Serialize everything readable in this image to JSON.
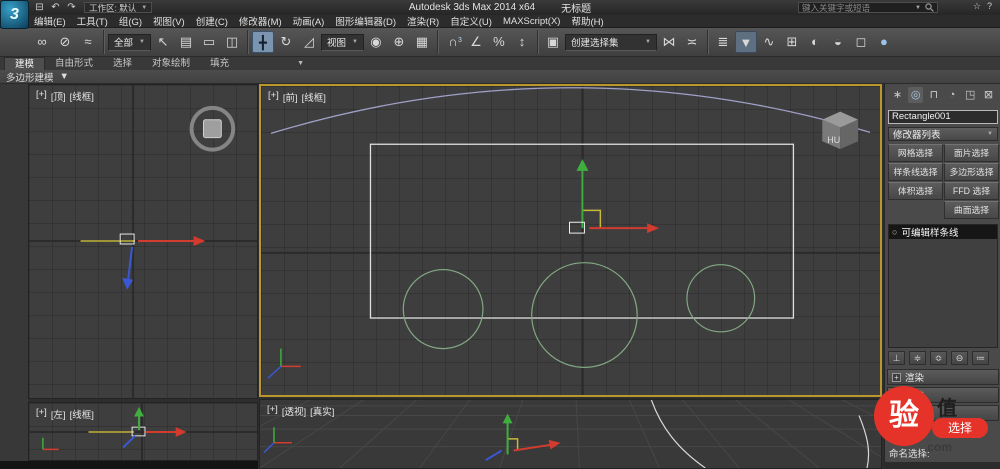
{
  "titlebar": {
    "workspace": "工作区: 默认",
    "product": "Autodesk 3ds Max  2014 x64",
    "document": "无标题",
    "search_placeholder": "键入关键字或短语"
  },
  "menubar": {
    "items": [
      "编辑(E)",
      "工具(T)",
      "组(G)",
      "视图(V)",
      "创建(C)",
      "修改器(M)",
      "动画(A)",
      "图形编辑器(D)",
      "渲染(R)",
      "自定义(U)",
      "MAXScript(X)",
      "帮助(H)"
    ]
  },
  "toolbar": {
    "filter_value": "全部",
    "coord_value": "视图",
    "selection_set_placeholder": "创建选择集",
    "snap_level": "3"
  },
  "ribbon": {
    "tabs": [
      "建模",
      "自由形式",
      "选择",
      "对象绘制",
      "填充"
    ],
    "panel_label": "多边形建模"
  },
  "viewports": {
    "top": {
      "plus": "[+]",
      "name": "[顶]",
      "shading": "[线框]"
    },
    "front": {
      "plus": "[+]",
      "name": "[前]",
      "shading": "[线框]"
    },
    "left": {
      "plus": "[+]",
      "name": "[左]",
      "shading": "[线框]"
    },
    "perspective": {
      "plus": "[+]",
      "name": "[透视]",
      "shading": "[真实]"
    },
    "viewcube_label": "HU"
  },
  "command_panel": {
    "object_name": "Rectangle001",
    "modifier_list": "修改器列表",
    "selection_buttons": [
      "网格选择",
      "面片选择",
      "样条线选择",
      "多边形选择",
      "体积选择",
      "FFD 选择",
      "",
      "曲面选择"
    ],
    "stack_items": [
      "可编辑样条线"
    ],
    "rollouts": [
      "渲染",
      "插值",
      "选择"
    ],
    "named_selection_label": "命名选择:"
  },
  "watermark": {
    "badge": "验",
    "char": "值",
    "pill": "选择",
    "suffix": ".com"
  },
  "icons": {
    "save": "⊟",
    "undo": "↶",
    "redo": "↷",
    "star": "☆",
    "help": "?",
    "dropdown_arrow": "▼",
    "expand": "+",
    "link": "∞",
    "unlink": "⊘",
    "bind": "≈",
    "select": "↖",
    "select_by_name": "▤",
    "rect_region": "▭",
    "window_crossing": "◫",
    "move": "╋",
    "rotate": "↻",
    "scale": "◿",
    "pivot": "◉",
    "manipulate": "⊕",
    "keyboard": "▦",
    "snap": "∩",
    "angle_snap": "∠",
    "percent_snap": "%",
    "spinner_snap": "↕",
    "named_sets": "▣",
    "mirror": "⋈",
    "align": "≍",
    "layers": "≣",
    "ribbon_toggle": "▼",
    "curve_editor": "∿",
    "schematic": "⊞",
    "material": "◐",
    "render_setup": "◒",
    "rendered_frame": "◻",
    "render": "●",
    "create_tab": "∗",
    "modify_tab": "◎",
    "hierarchy_tab": "⊓",
    "motion_tab": "◔",
    "display_tab": "◳",
    "utilities_tab": "⊠",
    "pin": "⊥",
    "show_end": "≑",
    "unique": "≎",
    "remove": "⊖",
    "config_sets": "≔",
    "lightbulb": "○"
  },
  "colors": {
    "active_viewport_border": "#b9972c",
    "accent_blue": "#7b95b1",
    "wire_white": "#e0e0e0",
    "wire_green": "#83a883",
    "arc_purple": "#a0a0c8",
    "axis_red": "#d23b2e",
    "axis_green": "#3fae3f",
    "axis_blue": "#3a58d6",
    "watermark_red": "#e6332a"
  }
}
